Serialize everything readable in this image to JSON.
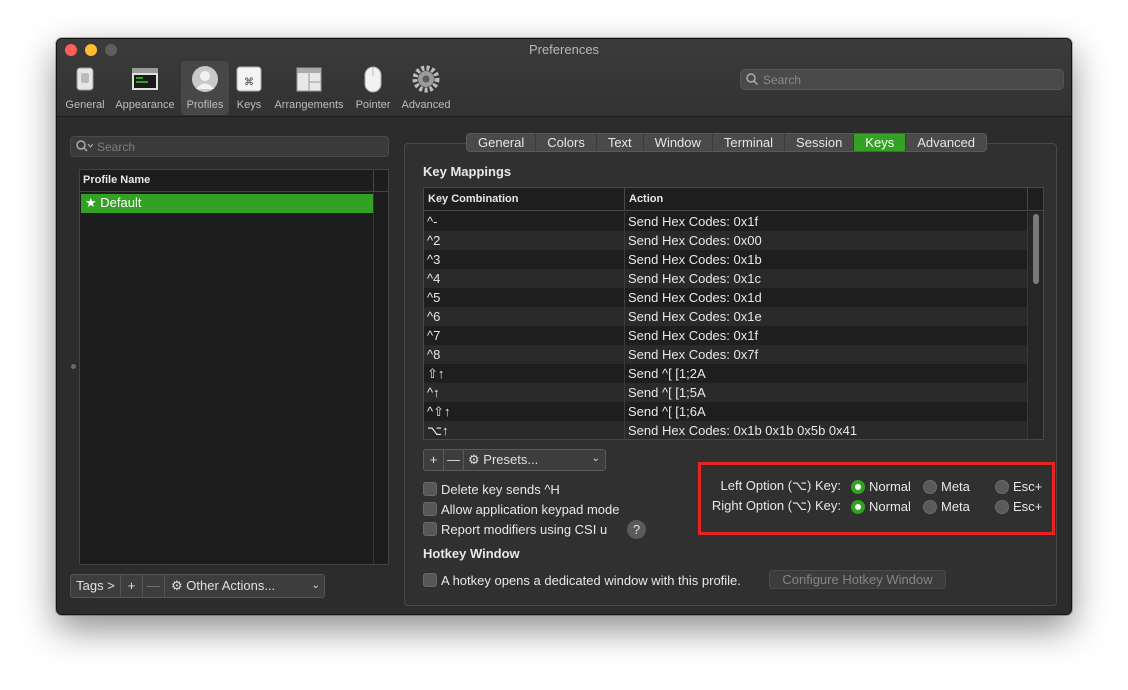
{
  "window": {
    "title": "Preferences"
  },
  "toolbar": {
    "items": [
      {
        "label": "General",
        "icon": "general-switch-icon"
      },
      {
        "label": "Appearance",
        "icon": "appearance-window-icon"
      },
      {
        "label": "Profiles",
        "icon": "profiles-person-icon",
        "active": true
      },
      {
        "label": "Keys",
        "icon": "keys-command-icon"
      },
      {
        "label": "Arrangements",
        "icon": "arrangements-windows-icon"
      },
      {
        "label": "Pointer",
        "icon": "pointer-mouse-icon"
      },
      {
        "label": "Advanced",
        "icon": "advanced-gear-icon"
      }
    ],
    "search_placeholder": "Search"
  },
  "profiles": {
    "search_placeholder": "Search",
    "column_header": "Profile Name",
    "items": [
      {
        "name": "Default",
        "is_default": true,
        "selected": true
      }
    ],
    "footer": {
      "tags_label": "Tags >",
      "add_label": "+",
      "remove_label": "—",
      "other_actions_label": "Other Actions..."
    }
  },
  "tabs": [
    {
      "label": "General"
    },
    {
      "label": "Colors"
    },
    {
      "label": "Text"
    },
    {
      "label": "Window"
    },
    {
      "label": "Terminal"
    },
    {
      "label": "Session"
    },
    {
      "label": "Keys",
      "active": true
    },
    {
      "label": "Advanced"
    }
  ],
  "key_mappings": {
    "title": "Key Mappings",
    "columns": [
      "Key Combination",
      "Action"
    ],
    "rows": [
      {
        "key": "^-",
        "action": "Send Hex Codes: 0x1f"
      },
      {
        "key": "^2",
        "action": "Send Hex Codes: 0x00"
      },
      {
        "key": "^3",
        "action": "Send Hex Codes: 0x1b"
      },
      {
        "key": "^4",
        "action": "Send Hex Codes: 0x1c"
      },
      {
        "key": "^5",
        "action": "Send Hex Codes: 0x1d"
      },
      {
        "key": "^6",
        "action": "Send Hex Codes: 0x1e"
      },
      {
        "key": "^7",
        "action": "Send Hex Codes: 0x1f"
      },
      {
        "key": "^8",
        "action": "Send Hex Codes: 0x7f"
      },
      {
        "key": "⇧↑",
        "action": "Send ^[ [1;2A"
      },
      {
        "key": "^↑",
        "action": "Send ^[ [1;5A"
      },
      {
        "key": "^⇧↑",
        "action": "Send ^[ [1;6A"
      },
      {
        "key": "⌥↑",
        "action": "Send Hex Codes: 0x1b 0x1b 0x5b 0x41"
      }
    ],
    "add_label": "+",
    "remove_label": "—",
    "presets_label": "Presets..."
  },
  "options": {
    "delete_key": "Delete key sends ^H",
    "keypad_mode": "Allow application keypad mode",
    "report_modifiers": "Report modifiers using CSI u",
    "help": "?"
  },
  "option_keys": {
    "left_label": "Left Option (⌥) Key:",
    "right_label": "Right Option (⌥) Key:",
    "choices": [
      "Normal",
      "Meta",
      "Esc+"
    ],
    "left_selected": "Normal",
    "right_selected": "Normal",
    "highlight_color": "#e8241e"
  },
  "hotkey": {
    "title": "Hotkey Window",
    "checkbox_label": "A hotkey opens a dedicated window with this profile.",
    "configure_label": "Configure Hotkey Window"
  },
  "colors": {
    "accent": "#33a224",
    "background": "#2c2c2c"
  }
}
